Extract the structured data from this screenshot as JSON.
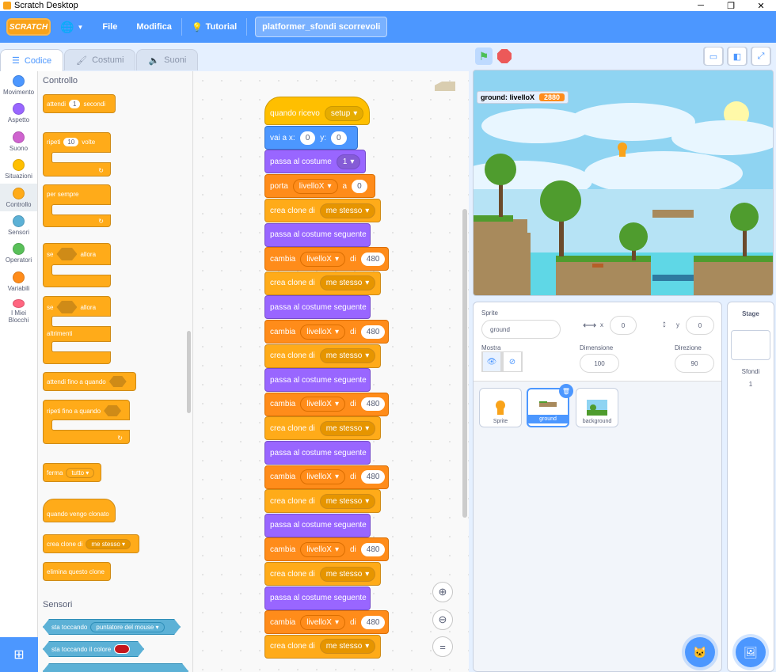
{
  "window": {
    "title": "Scratch Desktop",
    "min": "─",
    "max": "❐",
    "close": "✕"
  },
  "menubar": {
    "logo": "SCRATCH",
    "lang_icon": "globe-icon",
    "file": "File",
    "edit": "Modifica",
    "tutorial": "Tutorial",
    "project_title": "platformer_sfondi scorrevoli"
  },
  "tabs": [
    {
      "label": "Codice"
    },
    {
      "label": "Costumi"
    },
    {
      "label": "Suoni"
    }
  ],
  "categories": [
    {
      "label": "Movimento",
      "color": "#4c97ff"
    },
    {
      "label": "Aspetto",
      "color": "#9966ff"
    },
    {
      "label": "Suono",
      "color": "#cf63cf"
    },
    {
      "label": "Situazioni",
      "color": "#ffbf00"
    },
    {
      "label": "Controllo",
      "color": "#ffab19"
    },
    {
      "label": "Sensori",
      "color": "#5cb1d6"
    },
    {
      "label": "Operatori",
      "color": "#59c059"
    },
    {
      "label": "Variabili",
      "color": "#ff8c1a"
    },
    {
      "label": "I Miei Blocchi",
      "color": "#ff6680"
    }
  ],
  "palette": {
    "heading_control": "Controllo",
    "wait": "attendi",
    "wait_val": "1",
    "wait_unit": "secondi",
    "repeat": "ripeti",
    "repeat_val": "10",
    "repeat_tail": "volte",
    "forever": "per sempre",
    "if": "se",
    "then": "allora",
    "if2": "se",
    "then2": "allora",
    "else": "altrimenti",
    "wait_until": "attendi fino a quando",
    "repeat_until": "ripeti fino a quando",
    "stop": "ferma",
    "stop_opt": "tutto",
    "when_clone": "quando vengo clonato",
    "create_clone": "crea clone di",
    "create_clone_opt": "me stesso",
    "delete_clone": "elimina questo clone",
    "heading_sensing": "Sensori",
    "touching": "sta toccando",
    "touching_opt": "puntatore del mouse",
    "touching_color": "sta toccando il colore"
  },
  "script": {
    "hat": "quando ricevo",
    "hat_opt": "setup",
    "goto": "vai a x:",
    "goto_x": "0",
    "goto_y_label": "y:",
    "goto_y": "0",
    "switch_costume": "passa al costume",
    "costume_val": "1",
    "set_var": "porta",
    "set_var_name": "livelloX",
    "set_var_to": "a",
    "set_var_val": "0",
    "create_clone": "crea clone di",
    "clone_opt": "me stesso",
    "next_costume": "passa al costume seguente",
    "change": "cambia",
    "change_var": "livelloX",
    "change_by": "di",
    "change_val": "480"
  },
  "stage_header": {
    "flag_icon": "green-flag-icon",
    "stop_icon": "stop-icon"
  },
  "monitor": {
    "label": "ground: livelloX",
    "value": "2880"
  },
  "sprite_info": {
    "sprite_label": "Sprite",
    "sprite_name": "ground",
    "x_label": "x",
    "x_val": "0",
    "y_label": "y",
    "y_val": "0",
    "show_label": "Mostra",
    "size_label": "Dimensione",
    "size_val": "100",
    "dir_label": "Direzione",
    "dir_val": "90"
  },
  "sprites": [
    {
      "name": "Sprite"
    },
    {
      "name": "ground"
    },
    {
      "name": "background"
    }
  ],
  "stage_pane": {
    "title": "Stage",
    "backdrops_label": "Sfondi",
    "backdrops_count": "1"
  }
}
